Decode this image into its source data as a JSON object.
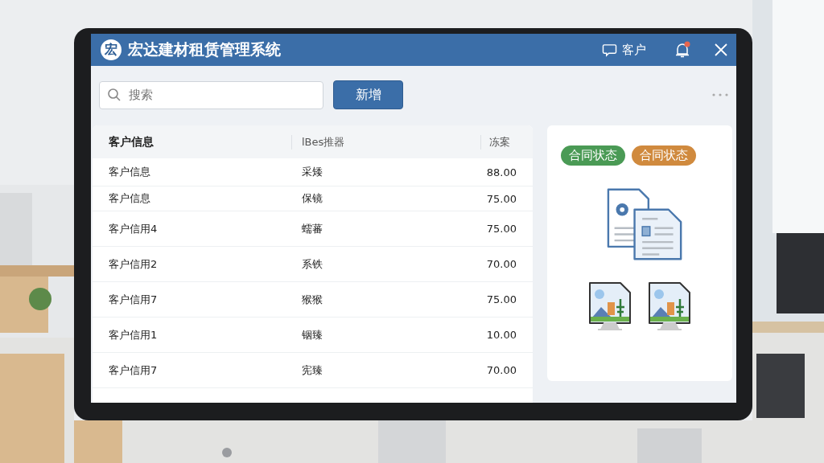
{
  "window": {
    "logo_text": "宏",
    "title": "宏达建材租赁管理系统",
    "user_label": "客户",
    "notification": true
  },
  "toolbar": {
    "search": {
      "placeholder": "搜索"
    },
    "add_button": "新增"
  },
  "table": {
    "columns": [
      "客户信息",
      "lBes推器",
      "冻案"
    ],
    "rows": [
      {
        "cells": [
          "客户信息",
          "采矮",
          "88.00"
        ]
      },
      {
        "cells": [
          "客户信息",
          "保镜",
          "75.00"
        ]
      },
      {
        "cells": [
          "客户信用4",
          "蠕蕃",
          "75.00"
        ]
      },
      {
        "cells": [
          "客户信用2",
          "系铁",
          "70.00"
        ]
      },
      {
        "cells": [
          "客户信用7",
          "猴猴",
          "75.00"
        ]
      },
      {
        "cells": [
          "客户信用1",
          "铟臻",
          "10.00"
        ]
      },
      {
        "cells": [
          "客户信用7",
          "宪臻",
          "70.00"
        ]
      }
    ]
  },
  "side_panel": {
    "tags": [
      {
        "label": "合同状态",
        "color": "#4a9a55"
      },
      {
        "label": "合同状态",
        "color": "#d08a3e"
      }
    ]
  }
}
